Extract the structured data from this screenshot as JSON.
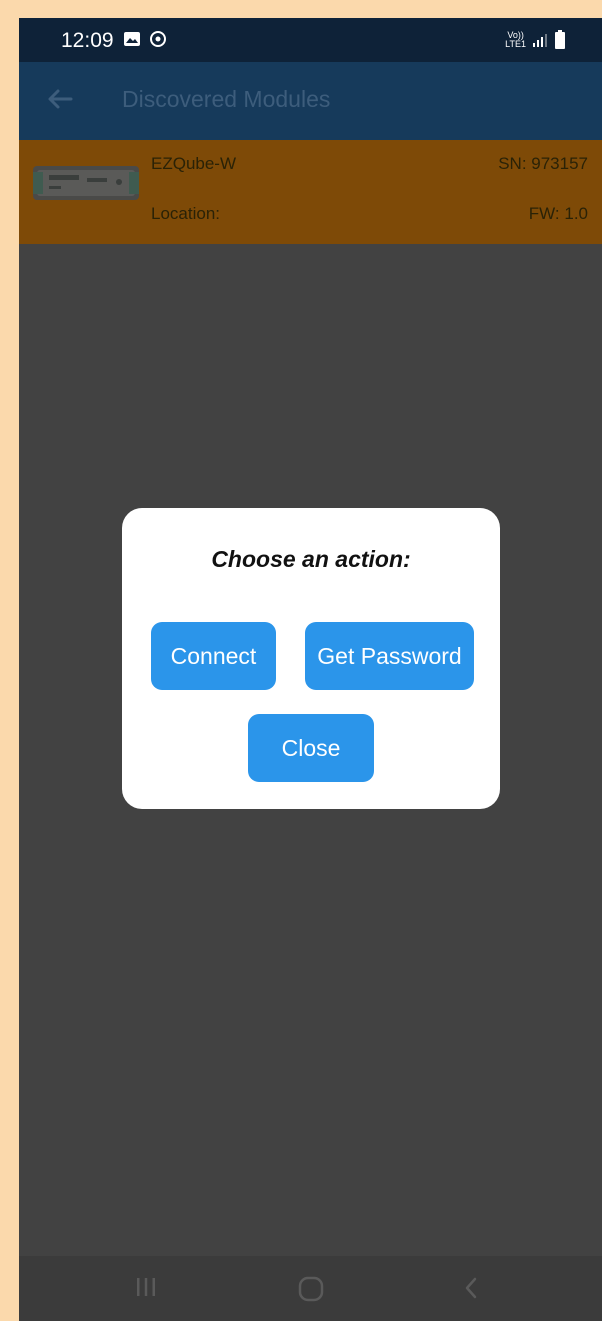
{
  "status_bar": {
    "time": "12:09",
    "network_label_top": "Vo))",
    "network_label_bottom": "LTE1",
    "icons_left": [
      "gallery-icon",
      "sync-icon"
    ],
    "icons_right": [
      "signal-icon",
      "battery-icon"
    ]
  },
  "app_bar": {
    "title": "Discovered Modules",
    "back_icon": "arrow-left-icon"
  },
  "module": {
    "name": "EZQube-W",
    "location_label": "Location:",
    "serial": "SN: 973157",
    "firmware": "FW: 1.0"
  },
  "dialog": {
    "title": "Choose an action:",
    "buttons": {
      "connect": "Connect",
      "get_password": "Get Password",
      "close": "Close"
    }
  },
  "nav_bar": {
    "icons": [
      "recents-icon",
      "home-icon",
      "back-icon"
    ]
  },
  "colors": {
    "status_bar": "#0e2238",
    "app_bar": "#163a5b",
    "module_row": "#7e4a07",
    "overlay": "#424242",
    "button": "#2b95ea",
    "frame": "#fbd9ac"
  }
}
